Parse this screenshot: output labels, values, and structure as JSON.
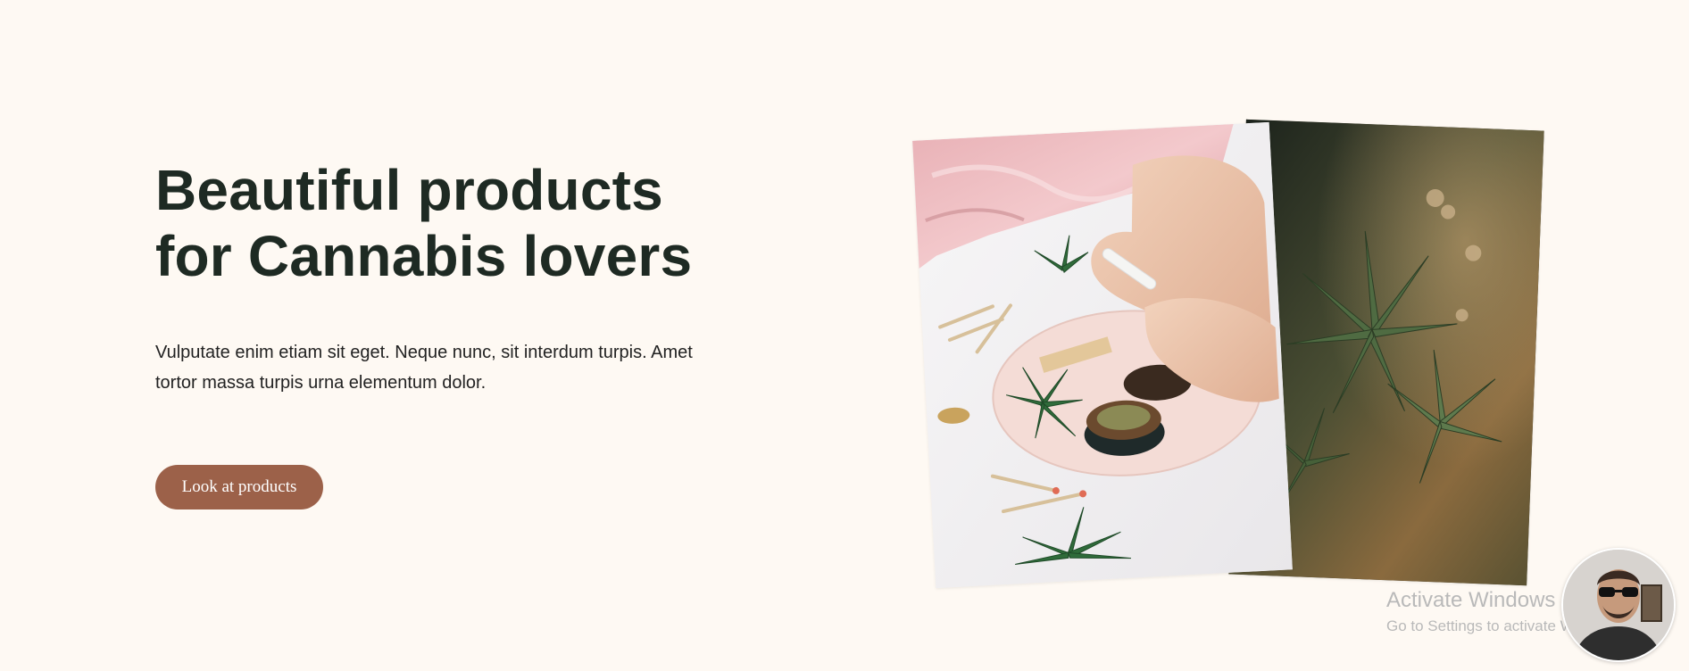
{
  "hero": {
    "title_line1": "Beautiful products",
    "title_line2": "for Cannabis lovers",
    "text_line1": "Vulputate enim etiam sit eget. Neque nunc, sit interdum turpis. Amet",
    "text_line2": "tortor massa turpis urna elementum dolor.",
    "cta_label": "Look at products"
  },
  "images": {
    "left": "hands-rolling-joint-photo",
    "right": "cannabis-plant-photo"
  },
  "watermark": {
    "title": "Activate Windows",
    "subtitle": "Go to Settings to activate Windows."
  },
  "avatar": {
    "name": "user-avatar-photo"
  },
  "colors": {
    "background": "#fef9f3",
    "title": "#1e2a23",
    "button": "#9c6149",
    "button_text": "#ffffff"
  }
}
